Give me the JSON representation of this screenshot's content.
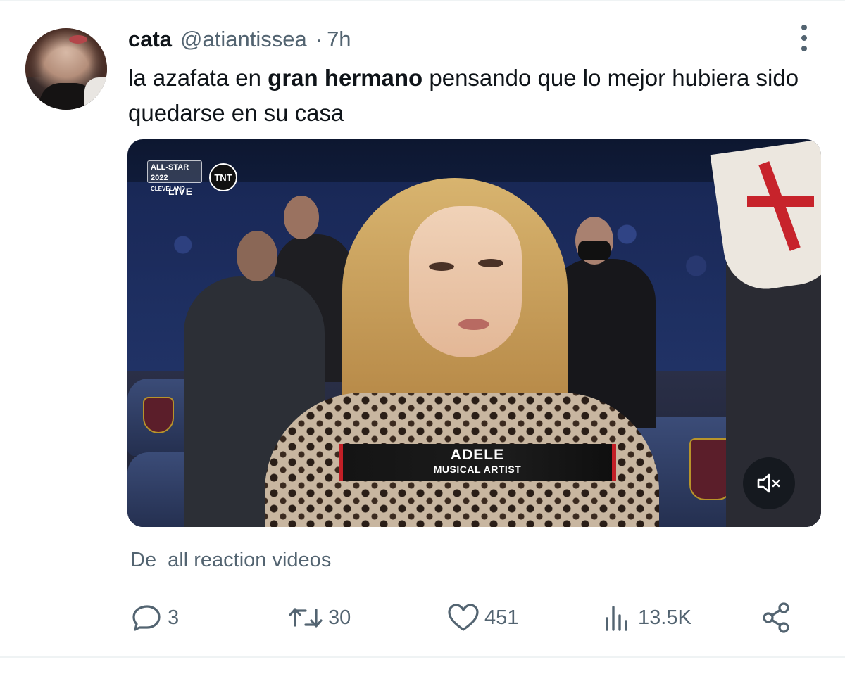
{
  "tweet": {
    "display_name": "cata",
    "handle": "@atiantissea",
    "separator": "·",
    "time": "7h",
    "text_before": "la azafata en ",
    "text_bold": "gran hermano",
    "text_after": " pensando que lo mejor hubiera sido quedarse en su casa"
  },
  "media": {
    "broadcast_badge_line1": "ALL-STAR 2022",
    "broadcast_badge_line2": "CLEVELAND",
    "broadcast_live": "LIVE",
    "network_logo": "TNT",
    "lower_third_name": "ADELE",
    "lower_third_role": "MUSICAL ARTIST",
    "mute_icon": "speaker-muted-icon"
  },
  "attribution": "De  all reaction videos",
  "actions": {
    "reply_count": "3",
    "retweet_count": "30",
    "like_count": "451",
    "views_count": "13.5K"
  },
  "icons": {
    "reply": "reply-icon",
    "retweet": "retweet-icon",
    "like": "heart-icon",
    "views": "views-icon",
    "share": "share-icon",
    "more": "more-options-icon"
  },
  "colors": {
    "text_primary": "#0f1419",
    "text_secondary": "#536471",
    "lower_third_accent": "#c21f26"
  }
}
